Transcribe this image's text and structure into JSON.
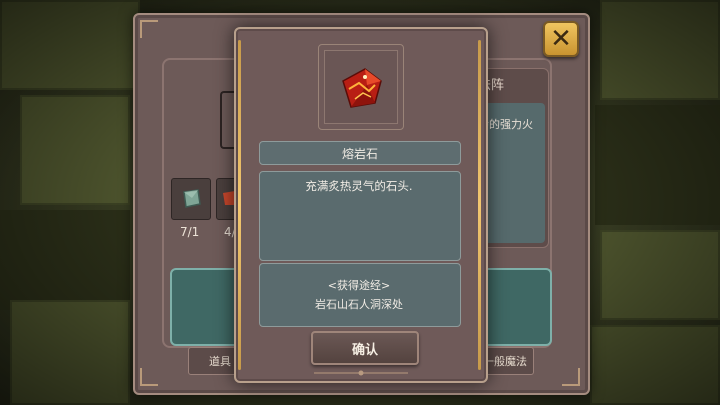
{
  "background_panel": {
    "right_card_title": "法阵",
    "right_card_description": "会的强力火",
    "slot_counts": [
      "7/1",
      "4/"
    ],
    "tabs": [
      "道具",
      "一般魔法"
    ]
  },
  "item_dialog": {
    "item_icon": "lava-stone-gem-icon",
    "item_name": "熔岩石",
    "description": "充满炙热灵气的石头.",
    "source_title": "<获得途经>",
    "source_text": "岩石山石人洞深处",
    "confirm_label": "确认"
  },
  "colors": {
    "dialog_bg": "#6f5a59",
    "info_box_bg": "#5a6b6e",
    "gold_accent": "#f3c770",
    "teal_panel": "#3f6864",
    "gem_red": "#c8281c"
  }
}
